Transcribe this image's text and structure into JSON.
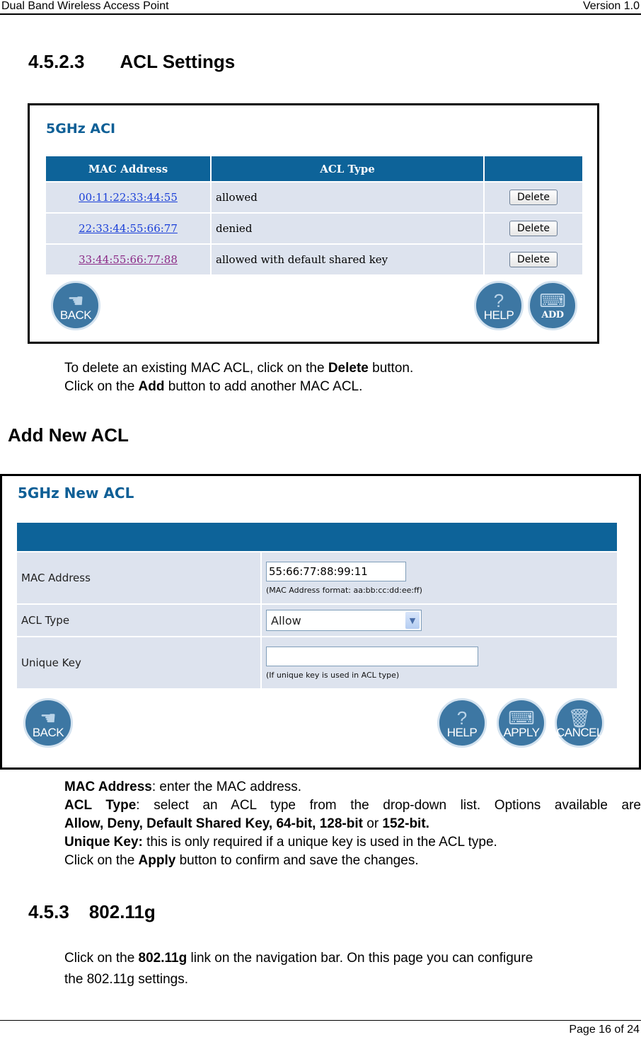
{
  "header": {
    "left": "Dual Band Wireless Access Point",
    "right": "Version 1.0"
  },
  "section1": {
    "number": "4.5.2.3",
    "title": "ACL Settings"
  },
  "acl_screen": {
    "title": "5GHz ACI",
    "columns": [
      "MAC Address",
      "ACL Type",
      ""
    ],
    "rows": [
      {
        "mac": "00:11:22:33:44:55",
        "type": "allowed",
        "action": "Delete",
        "visited": false
      },
      {
        "mac": "22:33:44:55:66:77",
        "type": "denied",
        "action": "Delete",
        "visited": false
      },
      {
        "mac": "33:44:55:66:77:88",
        "type": "allowed with default shared key",
        "action": "Delete",
        "visited": true
      }
    ],
    "buttons": {
      "back": "BACK",
      "help": "HELP",
      "add": "ADD"
    }
  },
  "para1": {
    "line1_pre": "To delete an existing MAC ACL, click on the ",
    "line1_bold": "Delete",
    "line1_post": " button.",
    "line2_pre": "Click on the ",
    "line2_bold": "Add",
    "line2_post": " button to add another MAC ACL."
  },
  "section_add": {
    "title": "Add New ACL"
  },
  "new_acl_screen": {
    "title": "5GHz New ACL",
    "fields": {
      "mac_label": "MAC Address",
      "mac_value": "55:66:77:88:99:11",
      "mac_hint": "(MAC Address format: aa:bb:cc:dd:ee:ff)",
      "type_label": "ACL Type",
      "type_value": "Allow",
      "key_label": "Unique Key",
      "key_value": "",
      "key_hint": "(If unique key is used in ACL type)"
    },
    "buttons": {
      "back": "BACK",
      "help": "HELP",
      "apply": "APPLY",
      "cancel": "CANCEL"
    }
  },
  "para2": {
    "mac_bold": "MAC Address",
    "mac_text": ": enter the MAC address.",
    "type_bold": "ACL Type",
    "type_text": ": select an ACL type from the drop-down list. Options available are",
    "options_bold": "Allow, Deny, Default Shared Key, 64-bit, 128-bit",
    "options_or": " or ",
    "options_last": "152-bit.",
    "key_bold": "Unique Key:",
    "key_text": " this is only required if a unique key is used in the ACL type.",
    "apply_pre": "Click on the ",
    "apply_bold": "Apply",
    "apply_post": " button to confirm and save the changes."
  },
  "section2": {
    "number": "4.5.3",
    "title": "802.11g"
  },
  "para3": {
    "pre": "Click on the ",
    "bold": "802.11g",
    "post": " link on the navigation bar.  On this page you can configure",
    "line2": "the 802.11g settings."
  },
  "footer": {
    "page": "Page 16 of 24"
  }
}
